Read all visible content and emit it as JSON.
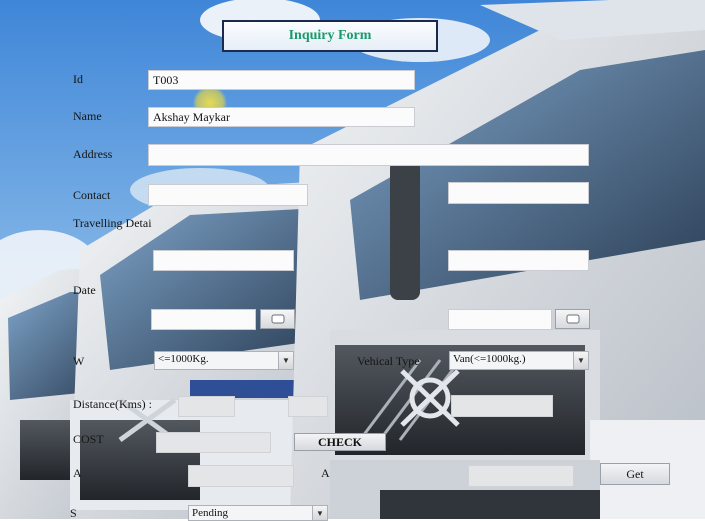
{
  "form": {
    "title": "Inquiry Form"
  },
  "fields": {
    "id": {
      "label": "Id",
      "value": "T003"
    },
    "name": {
      "label": "Name",
      "value": "Akshay Maykar"
    },
    "address": {
      "label": "Address",
      "value": ""
    },
    "contact": {
      "label": "Contact",
      "value1": "",
      "value2": ""
    },
    "travelling_details": {
      "label": "Travelling Detai"
    },
    "from_to": {
      "value1": "",
      "value2": ""
    },
    "date": {
      "label": "Date",
      "value1": "",
      "value2": ""
    },
    "weight": {
      "label": "W",
      "selected": "<=1000Kg."
    },
    "vehical_type": {
      "label": "Vehical Type",
      "selected": "Van(<=1000kg.)"
    },
    "distance": {
      "label": "Distance(Kms) :",
      "value": "",
      "value2": "",
      "extra": ""
    },
    "cost": {
      "label": "COST",
      "value": ""
    },
    "row_a": {
      "label": "A",
      "value": "",
      "label2": "A",
      "value2": ""
    },
    "status": {
      "label": "S",
      "selected": "Pending"
    }
  },
  "buttons": {
    "check": "CHECK",
    "get": "Get"
  },
  "icons": {
    "calendar": "calendar-icon",
    "dropdown": "chevron-down-icon"
  }
}
